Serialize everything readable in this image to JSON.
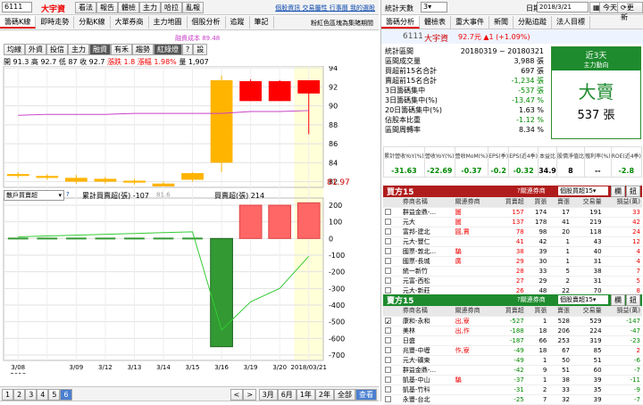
{
  "stock": {
    "code": "6111",
    "name": "大宇資",
    "price": "92.7",
    "change": "▲1 (+1.09%)"
  },
  "top_icons": [
    "看法",
    "報告",
    "體檢",
    "主力",
    "哈拉",
    "亂報"
  ],
  "top_links": [
    "個股資訊",
    "交易屬性",
    "行事曆",
    "我的選股"
  ],
  "main_tabs": [
    "籌碼K線",
    "即時走勢",
    "分點K線",
    "大單券商",
    "主力地圖",
    "個股分析",
    "追蹤",
    "筆記"
  ],
  "chart_info": "粉紅色區塊為集賭期間",
  "chart_btns": [
    "均線",
    "外資",
    "投信",
    "主力",
    "融資",
    "有禾",
    "趨勢",
    "紅綠燈",
    "?",
    "設"
  ],
  "chart_active": [
    "融資",
    "紅綠燈"
  ],
  "ohlc": {
    "open": "開 91.3",
    "high": "高 92.7",
    "low": "低 87",
    "close": "收 92.7",
    "chg": "漲跌 1.8",
    "pct": "漲幅 1.98%",
    "vol": "量 1,907"
  },
  "ma_label": "融資成本 89.48",
  "price_axis": [
    "94",
    "92",
    "90",
    "88",
    "86",
    "84",
    "82"
  ],
  "price_last": "81.97",
  "candles": [
    {
      "o": 82.8,
      "c": 82.6,
      "h": 83.0,
      "l": 82.4
    },
    {
      "o": 82.6,
      "c": 82.4,
      "h": 82.8,
      "l": 82.2
    },
    {
      "o": 82.4,
      "c": 82.0,
      "h": 82.7,
      "l": 81.8
    },
    {
      "o": 82.3,
      "c": 82.0,
      "h": 82.5,
      "l": 81.8
    },
    {
      "o": 82.1,
      "c": 81.9,
      "h": 82.3,
      "l": 81.7
    },
    {
      "o": 81.8,
      "c": 81.5,
      "h": 82.0,
      "l": 81.6
    },
    {
      "o": 82.9,
      "c": 82.2,
      "h": 83.0,
      "l": 82.0
    },
    {
      "o": 92.7,
      "c": 84.0,
      "h": 93.2,
      "l": 83.0
    },
    {
      "o": 90.5,
      "c": 92.6,
      "h": 92.8,
      "l": 90.5
    },
    {
      "o": 90.5,
      "c": 92.6,
      "h": 92.7,
      "l": 90.5
    },
    {
      "o": 91.3,
      "c": 92.7,
      "h": 92.7,
      "l": 87.0
    }
  ],
  "cost_ma": [
    89.0,
    89.1,
    89.1,
    89.1,
    89.2,
    89.2,
    89.2,
    89.2,
    89.4,
    89.4,
    89.5
  ],
  "low_label": "81.6",
  "vol_panel": {
    "select": "散戶買賣超",
    "legend1": "累計買賣超(張) -107",
    "legend2": "買賣超(張) 214"
  },
  "vol_axis": [
    "200",
    "100",
    "0",
    "-100",
    "-200",
    "-300",
    "-400",
    "-500",
    "-600",
    "-700"
  ],
  "vol_bars": [
    0,
    0,
    0,
    0,
    0,
    0,
    0,
    -650,
    200,
    200,
    214
  ],
  "vol_cum": [
    10,
    15,
    20,
    25,
    30,
    35,
    40,
    -550,
    -380,
    -300,
    -107
  ],
  "dates": [
    "3/08\n2018",
    "3/09",
    "3/12",
    "3/13",
    "3/14",
    "3/15",
    "3/16",
    "3/19",
    "3/20",
    "2018/03/21"
  ],
  "bottom_nums": [
    "1",
    "2",
    "3",
    "4",
    "5",
    "6"
  ],
  "bottom_ranges": [
    "3月",
    "6月",
    "1年",
    "2年",
    "全部"
  ],
  "bottom_active": "查看",
  "right_top": {
    "label": "統計天數",
    "days": "3",
    "date_label": "日期",
    "date": "2018/3/21",
    "today": "今天",
    "update": "更新"
  },
  "right_tabs": [
    "籌碼分析",
    "體檢表",
    "重大事件",
    "新聞",
    "分點追蹤",
    "法人目標"
  ],
  "stats": [
    {
      "k": "統計區間",
      "v": "20180319 ~ 20180321"
    },
    {
      "k": "區間成交量",
      "v": "3,988 張"
    },
    {
      "k": "買超前15名合計",
      "v": "697 張"
    },
    {
      "k": "賣超前15名合計",
      "v": "-1,234 張"
    },
    {
      "k": "3日籌碼集中",
      "v": "-537 張"
    },
    {
      "k": "3日籌碼集中(%)",
      "v": "-13.47 %"
    },
    {
      "k": "20日籌碼集中(%)",
      "v": "1.63 %"
    },
    {
      "k": "佔股本比重",
      "v": "-1.12 %"
    },
    {
      "k": "區間周轉率",
      "v": "8.34 %"
    }
  ],
  "signal": {
    "period": "近3天",
    "label": "主力動向",
    "action": "大賣",
    "amount": "537 張"
  },
  "fund_hdr": [
    "累計營收YoY(%)",
    "營收YoY(%)",
    "營收MoM(%)",
    "EPS(季)",
    "EPS(近4季)",
    "本益比",
    "股價淨值比",
    "殖利率(%)",
    "ROE(近4季)"
  ],
  "fund_val": [
    "-31.63",
    "-22.69",
    "-0.37",
    "-0.2",
    "-0.32",
    "34.9",
    "8",
    "--",
    "-2.8"
  ],
  "buy_title": "買方15",
  "buy_filter": "關連券商",
  "buy_select": "個股買超15",
  "sell_title": "賣方15",
  "sell_select": "個股賣超15",
  "grid_hdr": [
    "券商名稱",
    "關連券商",
    "買賣超",
    "買張",
    "賣張",
    "交易量",
    "損益(萬)"
  ],
  "buy_rows": [
    [
      "群益金鼎-...",
      "圖",
      "157",
      "174",
      "17",
      "191",
      "33"
    ],
    [
      "元大",
      "圖",
      "137",
      "178",
      "41",
      "219",
      "42"
    ],
    [
      "富邦-建北",
      "圓,賈",
      "78",
      "98",
      "20",
      "118",
      "24"
    ],
    [
      "元大-豐仁",
      "",
      "41",
      "42",
      "1",
      "43",
      "12"
    ],
    [
      "國票-敦北...",
      "騙",
      "38",
      "39",
      "1",
      "40",
      "4"
    ],
    [
      "國票-長城",
      "廣",
      "29",
      "30",
      "1",
      "31",
      "4"
    ],
    [
      "統一新竹",
      "",
      "28",
      "33",
      "5",
      "38",
      "7"
    ],
    [
      "元富-西松",
      "",
      "27",
      "29",
      "2",
      "31",
      "5"
    ],
    [
      "元大-新莊",
      "",
      "26",
      "48",
      "22",
      "70",
      "8"
    ]
  ],
  "sell_rows": [
    [
      "康和-永和",
      "出,寮",
      "-527",
      "1",
      "528",
      "529",
      "-147"
    ],
    [
      "美林",
      "出,作",
      "-188",
      "18",
      "206",
      "224",
      "-47"
    ],
    [
      "日盛",
      "",
      "-187",
      "66",
      "253",
      "319",
      "-23"
    ],
    [
      "兆豐-中壢",
      "作,寮",
      "-49",
      "18",
      "67",
      "85",
      "2"
    ],
    [
      "元大-礦東",
      "",
      "-49",
      "1",
      "50",
      "51",
      "-6"
    ],
    [
      "群益金鼎-...",
      "",
      "-42",
      "9",
      "51",
      "60",
      "-7"
    ],
    [
      "凱基-中山",
      "騙",
      "-37",
      "1",
      "38",
      "39",
      "-11"
    ],
    [
      "凱基-竹科",
      "",
      "-31",
      "2",
      "33",
      "35",
      "-9"
    ],
    [
      "永豐-台北",
      "",
      "-25",
      "7",
      "32",
      "39",
      "-7"
    ]
  ],
  "colors": {
    "up": "#ff0000",
    "down": "#ffb400",
    "ma": "#c840c8",
    "cum": "#33cc33",
    "neg": "#339933",
    "pos": "#ff6666",
    "highlight": "#ffffd8"
  }
}
